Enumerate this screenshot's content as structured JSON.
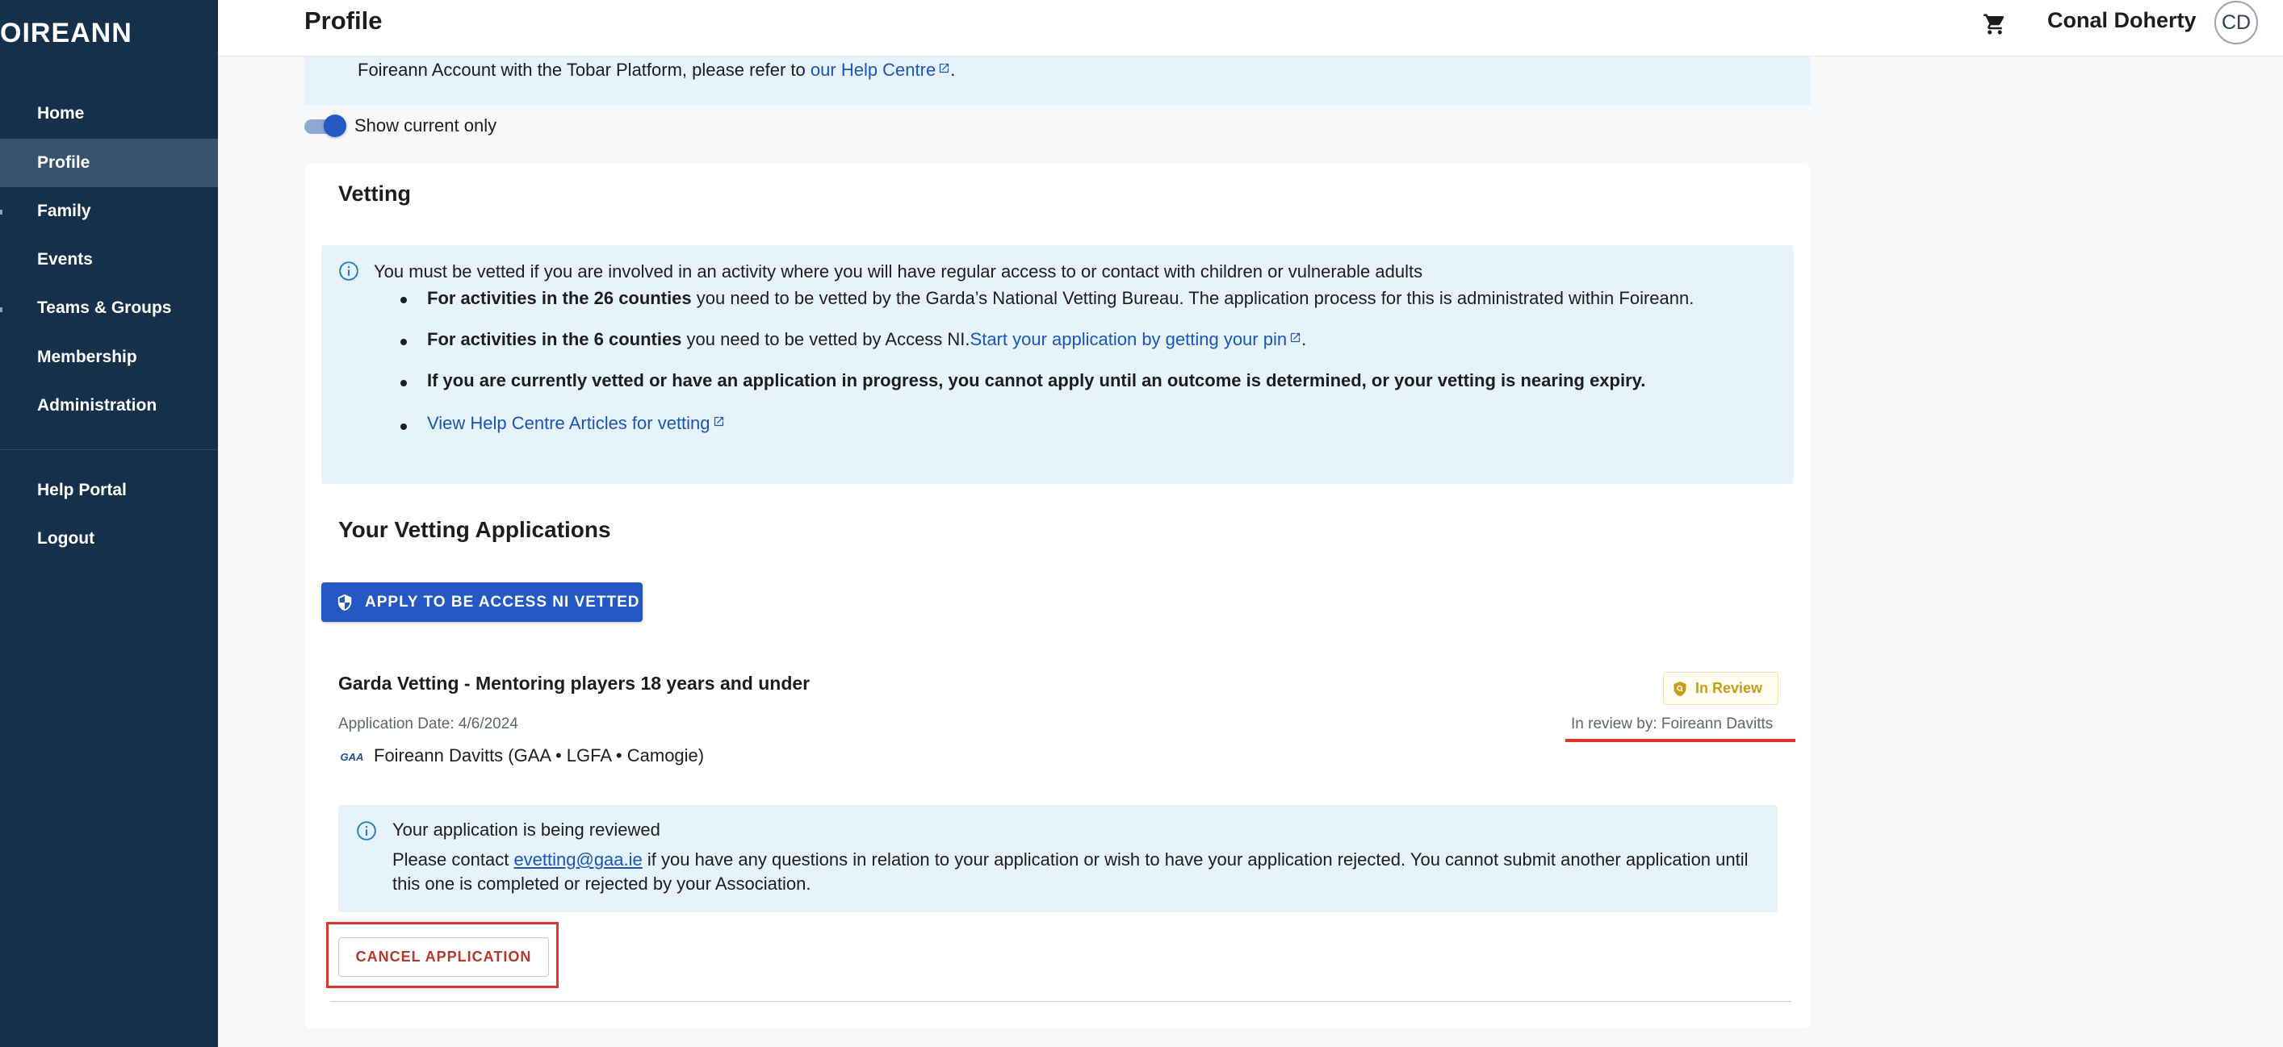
{
  "sidebar": {
    "brand": "OIREANN",
    "items": [
      {
        "label": "Home"
      },
      {
        "label": "Profile"
      },
      {
        "label": "Family"
      },
      {
        "label": "Events"
      },
      {
        "label": "Teams & Groups"
      },
      {
        "label": "Membership"
      },
      {
        "label": "Administration"
      }
    ],
    "footer_items": [
      {
        "label": "Help Portal"
      },
      {
        "label": "Logout"
      }
    ],
    "active_item": "Profile"
  },
  "header": {
    "title": "Profile",
    "user_name": "Conal Doherty",
    "avatar_initials": "CD",
    "cart_icon": "shopping-cart-icon"
  },
  "top_banner": {
    "text_before": "Foireann Account with the Tobar Platform, please refer to ",
    "link": "our Help Centre",
    "text_after": "."
  },
  "toggle": {
    "label": "Show current only",
    "checked": true
  },
  "vetting": {
    "title": "Vetting",
    "info_text": "You must be vetted if you are involved in an activity where you will have regular access to or contact with children or vulnerable adults",
    "bullets": [
      {
        "bold": "For activities in the 26 counties",
        "text": " you need to be vetted by the Garda’s National Vetting Bureau. The application process for this is administrated within Foireann."
      },
      {
        "bold": "For activities in the 6 counties",
        "text": " you need to be vetted by Access NI.",
        "link": "Start your application by getting your pin",
        "after": "."
      },
      {
        "bold": "If you are currently vetted or have an application in progress, you cannot apply until an outcome is determined, or your vetting is nearing expiry."
      },
      {
        "link": "View Help Centre Articles for vetting"
      }
    ]
  },
  "applications": {
    "title": "Your Vetting Applications",
    "apply_button": "APPLY TO BE ACCESS NI VETTED",
    "items": [
      {
        "title": "Garda Vetting - Mentoring players 18 years and under",
        "status": "In Review",
        "date": "Application Date: 4/6/2024",
        "reviewer": "In review by: Foireann Davitts",
        "org_logo": "GAA",
        "org": "Foireann Davitts (GAA • LGFA • Camogie)",
        "notice_heading": "Your application is being reviewed",
        "notice_before": "Please contact ",
        "notice_email": "evetting@gaa.ie",
        "notice_after": " if you have any questions in relation to your application or wish to have your application rejected. You cannot submit another application until this one is completed or rejected by your Association.",
        "cancel_button": "CANCEL APPLICATION"
      }
    ]
  },
  "colors": {
    "sidebar_bg": "#14304a",
    "primary": "#2458c4",
    "info_bg": "#e7f3fa",
    "highlight_red": "#e0352b",
    "status_gold": "#c69c1a"
  }
}
